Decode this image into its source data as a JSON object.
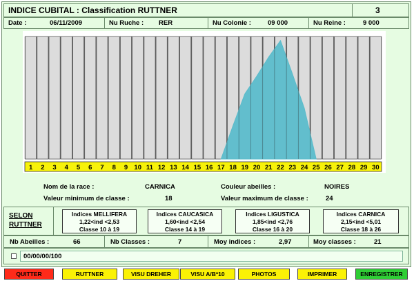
{
  "header": {
    "title": "INDICE CUBITAL :  Classification RUTTNER",
    "page_number": "3"
  },
  "info": {
    "date_label": "Date :",
    "date_value": "06/11/2009",
    "ruche_label": "Nu Ruche :",
    "ruche_value": "RER",
    "colonie_label": "Nu Colonie :",
    "colonie_value": "09 000",
    "reine_label": "Nu Reine :",
    "reine_value": "9 000"
  },
  "chart_data": {
    "type": "area",
    "categories": [
      "1",
      "2",
      "3",
      "4",
      "5",
      "6",
      "7",
      "8",
      "9",
      "10",
      "11",
      "12",
      "13",
      "14",
      "15",
      "16",
      "17",
      "18",
      "19",
      "20",
      "21",
      "22",
      "23",
      "24",
      "25",
      "26",
      "27",
      "28",
      "29",
      "30"
    ],
    "x": [
      17,
      18,
      19,
      20,
      21,
      22,
      23,
      24,
      25
    ],
    "values": [
      0,
      0.28,
      0.55,
      0.7,
      0.86,
      1.0,
      0.72,
      0.43,
      0
    ],
    "color": "#5bbccb",
    "bar_color": "#dcdcdc",
    "axis_label_bg": "#f7f20a"
  },
  "race": {
    "nom_label": "Nom de la race :",
    "nom_value": "CARNICA",
    "couleur_label": "Couleur abeilles :",
    "couleur_value": "NOIRES",
    "vmin_label": "Valeur minimum de classe :",
    "vmin_value": "18",
    "vmax_label": "Valeur maximum de classe :",
    "vmax_value": "24"
  },
  "selon": {
    "label_line1": "SELON",
    "label_line2": "RUTTNER",
    "boxes": [
      {
        "title": "Indices MELLIFERA",
        "range": "1,22<ind <2,53",
        "classe": "Classe 10 à 19"
      },
      {
        "title": "Indices CAUCASICA",
        "range": "1,60<ind <2,54",
        "classe": "Classe 14 à 19"
      },
      {
        "title": "Indices LIGUSTICA",
        "range": "1,85<ind <2,76",
        "classe": "Classe 16 à 20"
      },
      {
        "title": "Indices CARNICA",
        "range": "2,15<ind <5,01",
        "classe": "Classe 18 à 26"
      }
    ]
  },
  "stats": {
    "abeilles_label": "Nb Abeilles :",
    "abeilles_value": "66",
    "classes_label": "Nb Classes :",
    "classes_value": "7",
    "moy_ind_label": "Moy indices :",
    "moy_ind_value": "2,97",
    "moy_cls_label": "Moy classes :",
    "moy_cls_value": "21"
  },
  "code_field": {
    "value": "00/00/00/100"
  },
  "buttons": {
    "quitter": "QUITTER",
    "ruttner": "RUTTNER",
    "visu_dreher": "VISU DREHER",
    "visu_ab10": "VISU A/B*10",
    "photos": "PHOTOS",
    "imprimer": "IMPRIMER",
    "enregistrer": "ENREGISTRER"
  },
  "colors": {
    "panel_bg": "#e6fce2",
    "btn_red": "#ff2a1a",
    "btn_yellow": "#fbf205",
    "btn_green": "#2fce35"
  }
}
